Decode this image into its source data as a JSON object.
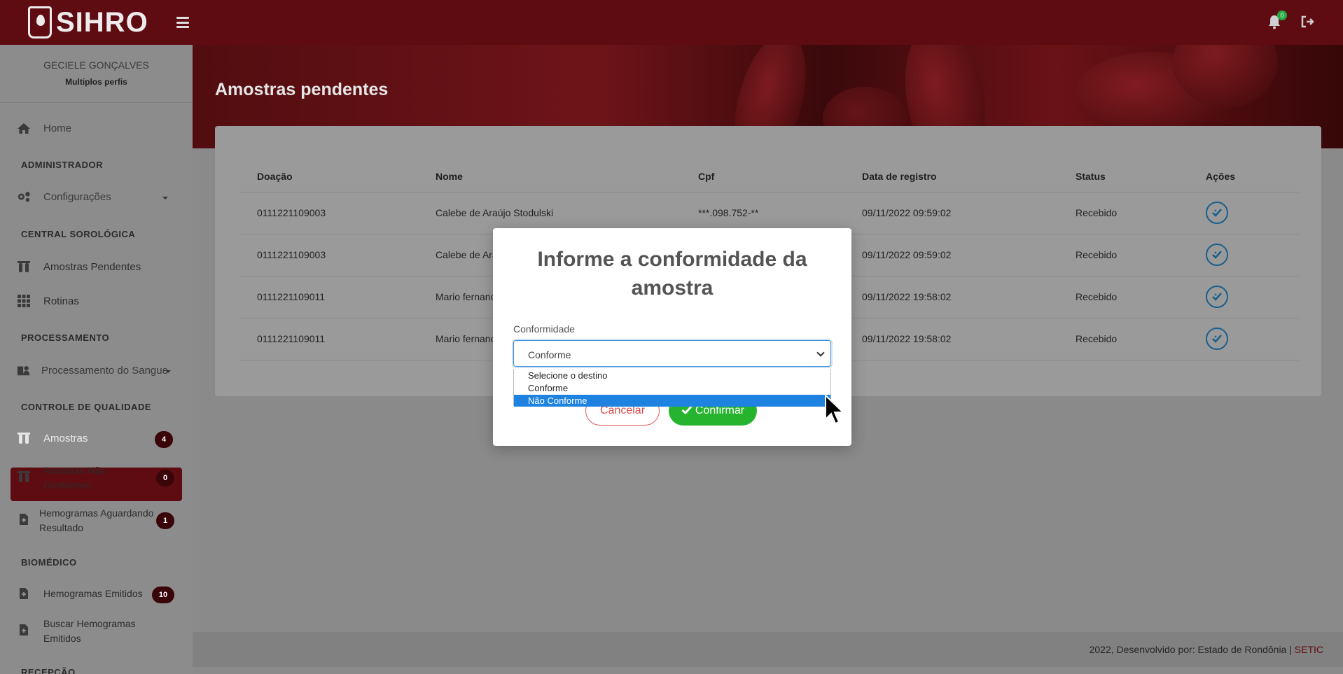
{
  "app": {
    "brand": "SIHRO",
    "notifications_count": "0"
  },
  "user": {
    "name": "GECIELE GONÇALVES",
    "role": "Multiplos perfis"
  },
  "sidebar": {
    "home": "Home",
    "sec_admin": "ADMINISTRADOR",
    "configuracoes": "Configurações",
    "sec_central": "CENTRAL SOROLÓGICA",
    "amostras_pendentes": "Amostras Pendentes",
    "rotinas": "Rotinas",
    "sec_processamento": "PROCESSAMENTO",
    "processamento_sangue": "Processamento do Sangue",
    "sec_qualidade": "CONTROLE DE QUALIDADE",
    "amostras": "Amostras",
    "amostras_badge": "4",
    "amostras_nc_1": "Amostras Não",
    "amostras_nc_2": "Conformes",
    "amostras_nc_badge": "0",
    "hemogramas_ag_1": "Hemogramas Aguardando",
    "hemogramas_ag_2": "Resultado",
    "hemogramas_ag_badge": "1",
    "sec_biomedico": "BIOMÉDICO",
    "hemogramas_emitidos": "Hemogramas Emitidos",
    "hemogramas_emitidos_badge": "10",
    "buscar_1": "Buscar Hemogramas",
    "buscar_2": "Emitidos",
    "sec_recepcao": "RECEPÇÃO"
  },
  "page": {
    "title": "Amostras pendentes"
  },
  "table": {
    "headers": [
      "Doação",
      "Nome",
      "Cpf",
      "Data de registro",
      "Status",
      "Ações"
    ],
    "rows": [
      {
        "doacao": "0111221109003",
        "nome": "Calebe de Araújo Stodulski",
        "cpf": "***.098.752-**",
        "data": "09/11/2022 09:59:02",
        "status": "Recebido"
      },
      {
        "doacao": "0111221109003",
        "nome": "Calebe de Ara",
        "cpf": "",
        "data": "09/11/2022 09:59:02",
        "status": "Recebido"
      },
      {
        "doacao": "0111221109011",
        "nome": "Mario fernanc",
        "cpf": "",
        "data": "09/11/2022 19:58:02",
        "status": "Recebido"
      },
      {
        "doacao": "0111221109011",
        "nome": "Mario fernanc",
        "cpf": "",
        "data": "09/11/2022 19:58:02",
        "status": "Recebido"
      }
    ]
  },
  "modal": {
    "title": "Informe a conformidade da amostra",
    "label": "Conformidade",
    "selected": "Conforme",
    "options": [
      "Selecione o destino",
      "Conforme",
      "Não Conforme"
    ],
    "highlighted_option": "Não Conforme",
    "cancel": "Cancelar",
    "confirm": "Confirmar"
  },
  "footer": {
    "text": "2022, Desenvolvido por: Estado de Rondônia | ",
    "link": "SETIC"
  },
  "colors": {
    "primary": "#5e0c11",
    "confirm": "#26b42e",
    "cancel": "#d54a4a",
    "highlight": "#1e82e0"
  }
}
